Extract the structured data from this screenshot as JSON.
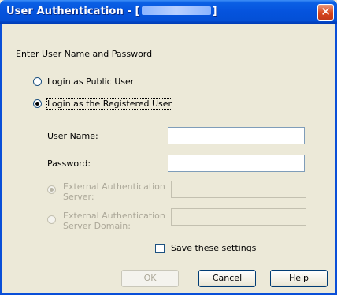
{
  "dialog": {
    "title_prefix": "User Authentication - [",
    "title_suffix": "]",
    "instruction": "Enter User Name and Password"
  },
  "login_options": [
    {
      "label": "Login as Public User",
      "selected": false
    },
    {
      "label": "Login as the Registered User",
      "selected": true
    }
  ],
  "fields": {
    "user_name_label": "User Name:",
    "user_name_value": "",
    "password_label": "Password:",
    "password_value": ""
  },
  "external": {
    "server_label_line1": "External Authentication",
    "server_label_line2": "Server:",
    "domain_label_line1": "External Authentication",
    "domain_label_line2": "Server Domain:"
  },
  "save_settings": {
    "label": "Save these settings",
    "checked": false
  },
  "buttons": {
    "ok": "OK",
    "cancel": "Cancel",
    "help": "Help"
  },
  "icons": {
    "close": "close-icon"
  }
}
